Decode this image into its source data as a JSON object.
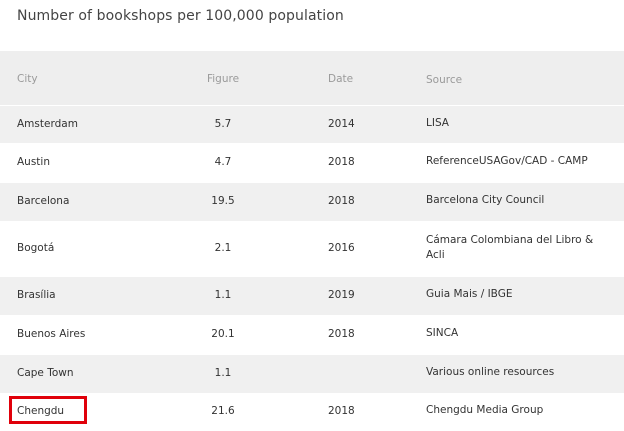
{
  "title": "Number of bookshops per 100,000 population",
  "headers": {
    "city": "City",
    "figure": "Figure",
    "date": "Date",
    "source": "Source"
  },
  "rows": [
    {
      "city": "Amsterdam",
      "figure": "5.7",
      "date": "2014",
      "source": "LISA"
    },
    {
      "city": "Austin",
      "figure": "4.7",
      "date": "2018",
      "source": "ReferenceUSAGov/CAD - CAMP"
    },
    {
      "city": "Barcelona",
      "figure": "19.5",
      "date": "2018",
      "source": "Barcelona City Council"
    },
    {
      "city": "Bogotá",
      "figure": "2.1",
      "date": "2016",
      "source": "Cámara Colombiana del Libro & Acli"
    },
    {
      "city": "Brasília",
      "figure": "1.1",
      "date": "2019",
      "source": "Guia Mais / IBGE"
    },
    {
      "city": "Buenos Aires",
      "figure": "20.1",
      "date": "2018",
      "source": "SINCA"
    },
    {
      "city": "Cape Town",
      "figure": "1.1",
      "date": "",
      "source": "Various online resources"
    },
    {
      "city": "Chengdu",
      "figure": "21.6",
      "date": "2018",
      "source": "Chengdu Media Group"
    }
  ],
  "highlight_color": "#e0000a"
}
